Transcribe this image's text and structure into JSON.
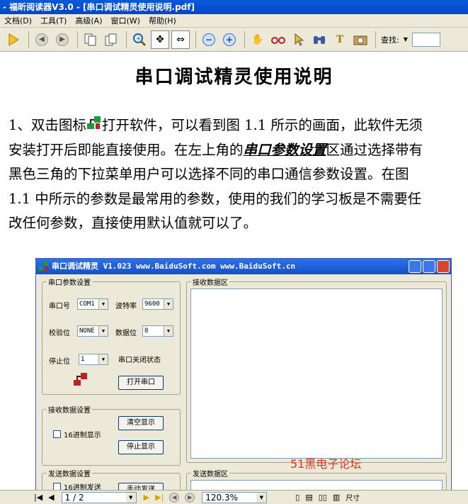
{
  "window": {
    "title": "- 福昕阅读器V3.0 - [串口调试精灵使用说明.pdf]"
  },
  "menu": [
    "文档(D)",
    "工具(T)",
    "高级(A)",
    "窗口(W)",
    "帮助(H)"
  ],
  "toolbar": {
    "find_label": "查找:"
  },
  "document": {
    "title": "串口调试精灵使用说明",
    "lines": [
      {
        "pre": "1、双击图标",
        "post": "打开软件，可以看到图 1.1 所示的画面，此软件无须"
      },
      {
        "pre": "安装打开后即能直接使用。在左上角的",
        "kw": "串口参数设置",
        "post": "区通过选择带有"
      },
      {
        "pre": "黑色三角的下拉菜单用户可以选择不同的串口通信参数设置。在图"
      },
      {
        "pre": "1.1 中所示的参数是最常用的参数，使用的我们的学习板是不需要任"
      },
      {
        "pre": "改任何参数，直接使用默认值就可以了。"
      }
    ]
  },
  "screenshot": {
    "title": "串口调试精灵 V1.023        www.BaiduSoft.com        www.BaiduSoft.cn",
    "serial_group": "串口参数设置",
    "port_label": "串口号",
    "port_value": "COM1",
    "baud_label": "波特率",
    "baud_value": "9600",
    "parity_label": "校验位",
    "parity_value": "NONE",
    "databits_label": "数据位",
    "databits_value": "8",
    "stopbits_label": "停止位",
    "stopbits_value": "1",
    "port_status": "串口关闭状态",
    "open_button": "打开串口",
    "recv_group": "接收数据设置",
    "recv_hex": "16进制显示",
    "clear_button": "清空显示",
    "stop_button": "停止显示",
    "send_group": "发送数据设置",
    "send_hex": "16进制发送",
    "manual_send_button": "手动发送",
    "recv_area_label": "接收数据区",
    "send_area_label": "发送数据区"
  },
  "watermark": "51黑电子论坛",
  "status": {
    "page": "1 / 2",
    "zoom": "120.3%",
    "size_label": "尺寸"
  },
  "colors": {
    "titlebar": "#0345c9",
    "watermark": "#e8321f"
  }
}
